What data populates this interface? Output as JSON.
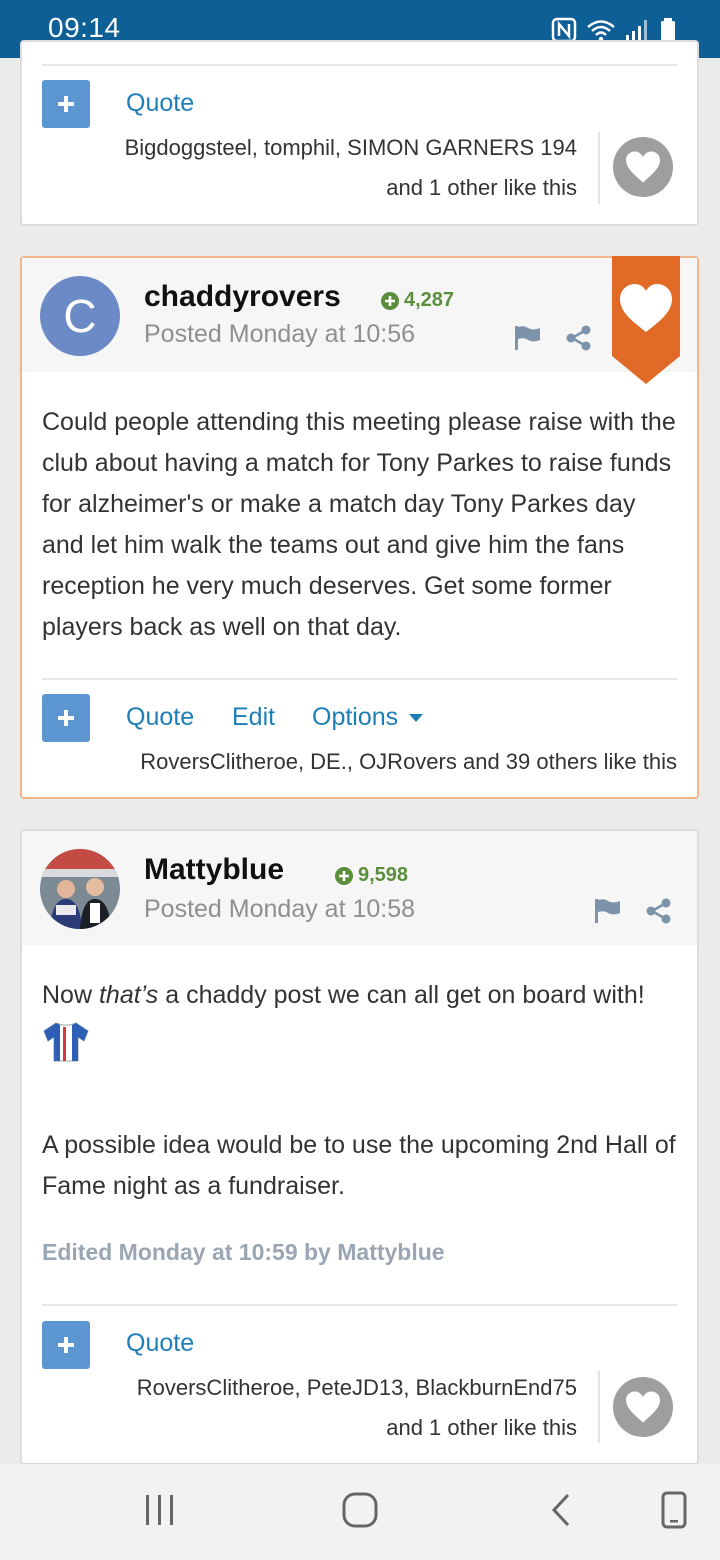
{
  "status_bar": {
    "time": "09:14"
  },
  "posts": [
    {
      "quote_label": "Quote",
      "likers_line1": "Bigdoggsteel, tomphil, SIMON GARNERS 194",
      "likers_line2": "and 1 other like this"
    },
    {
      "author": "chaddyrovers",
      "avatar_letter": "C",
      "avatar_color": "#6b8ac6",
      "reputation": "4,287",
      "posted": "Posted Monday at 10:56",
      "body": "Could people attending this meeting please raise with the club about having a match for Tony Parkes to raise funds for alzheimer's or make a match day Tony Parkes day and let him walk the teams out and give him the fans reception he very much deserves. Get some former players back as well on that day.",
      "actions": {
        "quote": "Quote",
        "edit": "Edit",
        "options": "Options"
      },
      "likers": "RoversClitheroe, DE., OJRovers and 39 others like this",
      "ribbon_color": "#e06a26"
    },
    {
      "author": "Mattyblue",
      "reputation": "9,598",
      "posted": "Posted Monday at 10:58",
      "body_pre": "Now ",
      "body_em": "that’s",
      "body_post": " a chaddy post we can all get on board with!",
      "body_para2": "A possible idea would be to use the upcoming 2nd Hall of Fame night as a fundraiser.",
      "edited": "Edited Monday at 10:59 by Mattyblue",
      "quote_label": "Quote",
      "likers_line1": "RoversClitheroe, PeteJD13, BlackburnEnd75",
      "likers_line2": "and 1 other like this"
    }
  ],
  "icons": {
    "nfc": "nfc-icon",
    "wifi": "wifi-icon",
    "signal": "signal-icon",
    "battery": "battery-icon",
    "heart": "heart-icon",
    "flag": "flag-icon",
    "share": "share-icon",
    "plus": "plus-icon",
    "caret": "caret-down-icon",
    "shirt": "football-shirt-icon",
    "recent": "recent-apps-icon",
    "home": "home-icon",
    "back": "back-icon",
    "rotate": "rotate-icon"
  }
}
